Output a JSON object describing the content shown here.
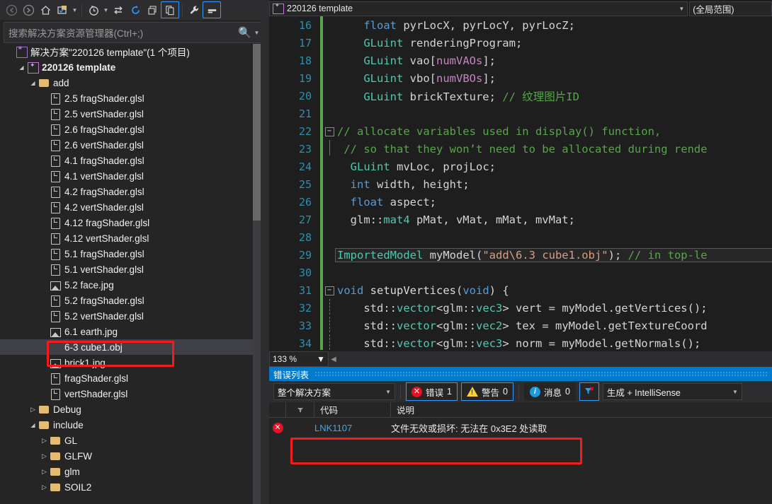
{
  "solution_explorer": {
    "toolbar": [
      {
        "name": "back-button",
        "icon": "arrow-left-icon",
        "disabled": true
      },
      {
        "name": "forward-button",
        "icon": "arrow-right-icon",
        "disabled": true
      },
      {
        "name": "home-button",
        "icon": "home-icon"
      },
      {
        "name": "show-all-files-button",
        "icon": "folder-properties-icon"
      },
      {
        "name": "show-all-files-dropdown",
        "icon": "chevron-down-icon"
      },
      {
        "name": "pending-changes-button",
        "icon": "clock-icon"
      },
      {
        "name": "pending-changes-dropdown",
        "icon": "chevron-down-icon"
      },
      {
        "name": "sync-with-active-document-button",
        "icon": "sync-arrows-icon"
      },
      {
        "name": "refresh-button",
        "icon": "refresh-icon"
      },
      {
        "name": "collapse-all-button",
        "icon": "collapse-all-icon"
      },
      {
        "name": "view-code-button",
        "icon": "copy-pages-icon",
        "framed": true
      },
      {
        "name": "properties-button",
        "icon": "wrench-icon"
      },
      {
        "name": "preview-selected-items-button",
        "icon": "preview-icon",
        "framed": true
      }
    ],
    "search": {
      "placeholder": "搜索解决方案资源管理器(Ctrl+;)",
      "icon": "search-icon",
      "dropdown_icon": "chevron-down-icon"
    },
    "tree": [
      {
        "label": "解决方案\"220126 template\"(1 个项目)",
        "depth": 0,
        "icon": "solution-icon",
        "expander": "none",
        "bold": false
      },
      {
        "label": "220126 template",
        "depth": 1,
        "icon": "project-icon",
        "expander": "expanded",
        "bold": true
      },
      {
        "label": "add",
        "depth": 2,
        "icon": "folder-open-icon",
        "expander": "expanded",
        "bold": false
      },
      {
        "label": "2.5 fragShader.glsl",
        "depth": 3,
        "icon": "file-icon",
        "expander": "none",
        "bold": false
      },
      {
        "label": "2.5 vertShader.glsl",
        "depth": 3,
        "icon": "file-icon",
        "expander": "none",
        "bold": false
      },
      {
        "label": "2.6 fragShader.glsl",
        "depth": 3,
        "icon": "file-icon",
        "expander": "none",
        "bold": false
      },
      {
        "label": "2.6 vertShader.glsl",
        "depth": 3,
        "icon": "file-icon",
        "expander": "none",
        "bold": false
      },
      {
        "label": "4.1 fragShader.glsl",
        "depth": 3,
        "icon": "file-icon",
        "expander": "none",
        "bold": false
      },
      {
        "label": "4.1 vertShader.glsl",
        "depth": 3,
        "icon": "file-icon",
        "expander": "none",
        "bold": false
      },
      {
        "label": "4.2 fragShader.glsl",
        "depth": 3,
        "icon": "file-icon",
        "expander": "none",
        "bold": false
      },
      {
        "label": "4.2 vertShader.glsl",
        "depth": 3,
        "icon": "file-icon",
        "expander": "none",
        "bold": false
      },
      {
        "label": "4.12 fragShader.glsl",
        "depth": 3,
        "icon": "file-icon",
        "expander": "none",
        "bold": false
      },
      {
        "label": "4.12 vertShader.glsl",
        "depth": 3,
        "icon": "file-icon",
        "expander": "none",
        "bold": false
      },
      {
        "label": "5.1 fragShader.glsl",
        "depth": 3,
        "icon": "file-icon",
        "expander": "none",
        "bold": false
      },
      {
        "label": "5.1 vertShader.glsl",
        "depth": 3,
        "icon": "file-icon",
        "expander": "none",
        "bold": false
      },
      {
        "label": "5.2 face.jpg",
        "depth": 3,
        "icon": "image-icon",
        "expander": "none",
        "bold": false
      },
      {
        "label": "5.2 fragShader.glsl",
        "depth": 3,
        "icon": "file-icon",
        "expander": "none",
        "bold": false
      },
      {
        "label": "5.2 vertShader.glsl",
        "depth": 3,
        "icon": "file-icon",
        "expander": "none",
        "bold": false
      },
      {
        "label": "6.1 earth.jpg",
        "depth": 3,
        "icon": "image-icon",
        "expander": "none",
        "bold": false
      },
      {
        "label": "6-3 cube1.obj",
        "depth": 3,
        "icon": "file-icon",
        "expander": "none",
        "bold": false,
        "selected": true,
        "highlighted": true
      },
      {
        "label": "brick1.jpg",
        "depth": 3,
        "icon": "image-icon",
        "expander": "none",
        "bold": false
      },
      {
        "label": "fragShader.glsl",
        "depth": 3,
        "icon": "file-icon",
        "expander": "none",
        "bold": false
      },
      {
        "label": "vertShader.glsl",
        "depth": 3,
        "icon": "file-icon",
        "expander": "none",
        "bold": false
      },
      {
        "label": "Debug",
        "depth": 2,
        "icon": "folder-icon",
        "expander": "collapsed",
        "bold": false
      },
      {
        "label": "include",
        "depth": 2,
        "icon": "folder-open-icon",
        "expander": "expanded",
        "bold": false
      },
      {
        "label": "GL",
        "depth": 3,
        "icon": "folder-icon",
        "expander": "collapsed",
        "bold": false
      },
      {
        "label": "GLFW",
        "depth": 3,
        "icon": "folder-icon",
        "expander": "collapsed",
        "bold": false
      },
      {
        "label": "glm",
        "depth": 3,
        "icon": "folder-icon",
        "expander": "collapsed",
        "bold": false
      },
      {
        "label": "SOIL2",
        "depth": 3,
        "icon": "folder-icon",
        "expander": "collapsed",
        "bold": false
      }
    ]
  },
  "editor": {
    "nav_project": "220126 template",
    "nav_scope": "(全局范围)",
    "zoom_level": "133 %",
    "lines": [
      {
        "num": "16",
        "change": true,
        "glyph": "",
        "tokens": [
          {
            "t": "    ",
            "c": "p"
          },
          {
            "t": "float",
            "c": "k"
          },
          {
            "t": " pyrLocX, pyrLocY, pyrLocZ;",
            "c": "p"
          }
        ]
      },
      {
        "num": "17",
        "change": true,
        "glyph": "",
        "tokens": [
          {
            "t": "    ",
            "c": "p"
          },
          {
            "t": "GLuint",
            "c": "t"
          },
          {
            "t": " renderingProgram;",
            "c": "p"
          }
        ]
      },
      {
        "num": "18",
        "change": true,
        "glyph": "",
        "tokens": [
          {
            "t": "    ",
            "c": "p"
          },
          {
            "t": "GLuint",
            "c": "t"
          },
          {
            "t": " vao[",
            "c": "p"
          },
          {
            "t": "numVAOs",
            "c": "mac"
          },
          {
            "t": "];",
            "c": "p"
          }
        ]
      },
      {
        "num": "19",
        "change": true,
        "glyph": "",
        "tokens": [
          {
            "t": "    ",
            "c": "p"
          },
          {
            "t": "GLuint",
            "c": "t"
          },
          {
            "t": " vbo[",
            "c": "p"
          },
          {
            "t": "numVBOs",
            "c": "mac"
          },
          {
            "t": "];",
            "c": "p"
          }
        ]
      },
      {
        "num": "20",
        "change": true,
        "glyph": "",
        "tokens": [
          {
            "t": "    ",
            "c": "p"
          },
          {
            "t": "GLuint",
            "c": "t"
          },
          {
            "t": " brickTexture; ",
            "c": "p"
          },
          {
            "t": "// 纹理图片ID",
            "c": "c"
          }
        ]
      },
      {
        "num": "21",
        "change": true,
        "glyph": "",
        "tokens": [
          {
            "t": "",
            "c": "p"
          }
        ]
      },
      {
        "num": "22",
        "change": true,
        "glyph": "minus",
        "tokens": [
          {
            "t": "// allocate variables used in display() function,",
            "c": "c"
          }
        ]
      },
      {
        "num": "23",
        "change": true,
        "glyph": "bar",
        "tokens": [
          {
            "t": " // so that they won’t need to be allocated during rende",
            "c": "c"
          }
        ]
      },
      {
        "num": "24",
        "change": true,
        "glyph": "",
        "tokens": [
          {
            "t": "  ",
            "c": "p"
          },
          {
            "t": "GLuint",
            "c": "t"
          },
          {
            "t": " mvLoc, projLoc;",
            "c": "p"
          }
        ]
      },
      {
        "num": "25",
        "change": true,
        "glyph": "",
        "tokens": [
          {
            "t": "  ",
            "c": "p"
          },
          {
            "t": "int",
            "c": "k"
          },
          {
            "t": " width, height;",
            "c": "p"
          }
        ]
      },
      {
        "num": "26",
        "change": true,
        "glyph": "",
        "tokens": [
          {
            "t": "  ",
            "c": "p"
          },
          {
            "t": "float",
            "c": "k"
          },
          {
            "t": " aspect;",
            "c": "p"
          }
        ]
      },
      {
        "num": "27",
        "change": true,
        "glyph": "",
        "tokens": [
          {
            "t": "  glm::",
            "c": "p"
          },
          {
            "t": "mat4",
            "c": "t"
          },
          {
            "t": " pMat, vMat, mMat, mvMat;",
            "c": "p"
          }
        ]
      },
      {
        "num": "28",
        "change": true,
        "glyph": "",
        "tokens": [
          {
            "t": "",
            "c": "p"
          }
        ]
      },
      {
        "num": "29",
        "change": true,
        "glyph": "",
        "boxed": true,
        "tokens": [
          {
            "t": "ImportedModel",
            "c": "t"
          },
          {
            "t": " myModel(",
            "c": "p"
          },
          {
            "t": "\"add\\6.3 cube1.obj\"",
            "c": "s"
          },
          {
            "t": "); ",
            "c": "p"
          },
          {
            "t": "// in top-le",
            "c": "c"
          }
        ]
      },
      {
        "num": "30",
        "change": true,
        "glyph": "",
        "tokens": [
          {
            "t": "",
            "c": "p"
          }
        ]
      },
      {
        "num": "31",
        "change": true,
        "glyph": "minus",
        "tokens": [
          {
            "t": "void",
            "c": "k"
          },
          {
            "t": " ",
            "c": "p"
          },
          {
            "t": "setupVertices",
            "c": "fn"
          },
          {
            "t": "(",
            "c": "p"
          },
          {
            "t": "void",
            "c": "k"
          },
          {
            "t": ") {",
            "c": "p"
          }
        ]
      },
      {
        "num": "32",
        "change": true,
        "glyph": "pipe",
        "tokens": [
          {
            "t": "    std::",
            "c": "p"
          },
          {
            "t": "vector",
            "c": "t"
          },
          {
            "t": "<glm::",
            "c": "p"
          },
          {
            "t": "vec3",
            "c": "t"
          },
          {
            "t": "> vert = myModel.getVertices();",
            "c": "p"
          }
        ]
      },
      {
        "num": "33",
        "change": true,
        "glyph": "pipe",
        "tokens": [
          {
            "t": "    std::",
            "c": "p"
          },
          {
            "t": "vector",
            "c": "t"
          },
          {
            "t": "<glm::",
            "c": "p"
          },
          {
            "t": "vec2",
            "c": "t"
          },
          {
            "t": "> tex = myModel.getTextureCoord",
            "c": "p"
          }
        ]
      },
      {
        "num": "34",
        "change": true,
        "glyph": "pipe",
        "tokens": [
          {
            "t": "    std::",
            "c": "p"
          },
          {
            "t": "vector",
            "c": "t"
          },
          {
            "t": "<glm::",
            "c": "p"
          },
          {
            "t": "vec3",
            "c": "t"
          },
          {
            "t": "> norm = myModel.getNormals();",
            "c": "p"
          }
        ]
      }
    ]
  },
  "error_list": {
    "title": "错误列表",
    "scope_filter": "整个解决方案",
    "errors": {
      "label": "错误",
      "count": "1",
      "icon": "error-icon",
      "active": true
    },
    "warnings": {
      "label": "警告",
      "count": "0",
      "icon": "warning-icon",
      "active": true
    },
    "messages": {
      "label": "消息",
      "count": "0",
      "icon": "info-icon",
      "active": false
    },
    "filter_button_icon": "clear-filter-icon",
    "build_filter": "生成 + IntelliSense",
    "columns": [
      "",
      "",
      "代码",
      "说明"
    ],
    "rows": [
      {
        "severity_icon": "error-icon",
        "code": "LNK1107",
        "description": "文件无效或损坏: 无法在 0x3E2 处读取",
        "highlighted": true
      }
    ]
  }
}
